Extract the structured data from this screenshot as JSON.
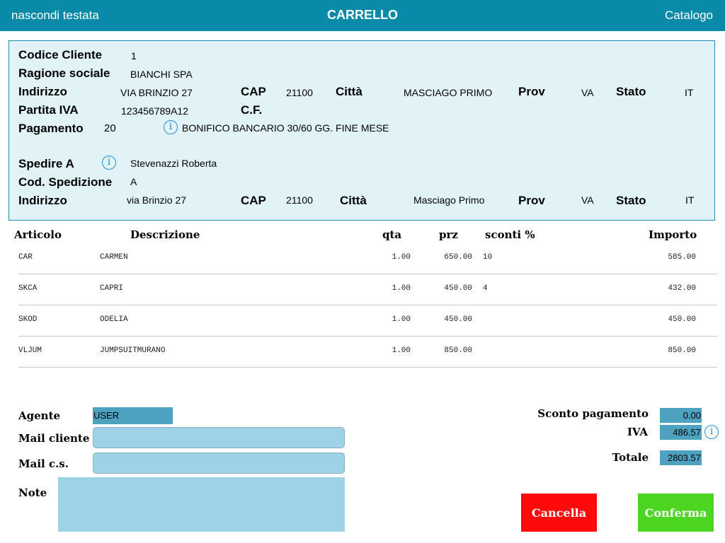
{
  "navbar": {
    "left": "nascondi testata",
    "title": "CARRELLO",
    "right": "Catalogo"
  },
  "header": {
    "codice_cliente": {
      "label": "Codice Cliente",
      "value": "1"
    },
    "ragione_sociale": {
      "label": "Ragione sociale",
      "value": "BIANCHI SPA"
    },
    "indirizzo": {
      "label": "Indirizzo",
      "value": "VIA BRINZIO 27",
      "cap_label": "CAP",
      "cap": "21100",
      "citta_label": "Città",
      "citta": "MASCIAGO PRIMO",
      "prov_label": "Prov",
      "prov": "VA",
      "stato_label": "Stato",
      "stato": "IT"
    },
    "partita_iva": {
      "label": "Partita IVA",
      "value": "123456789A12",
      "cf_label": "C.F.",
      "cf": ""
    },
    "pagamento": {
      "label": "Pagamento",
      "code": "20",
      "description": "BONIFICO BANCARIO 30/60 GG. FINE MESE"
    },
    "spedire_a": {
      "label": "Spedire A",
      "value": "Stevenazzi Roberta"
    },
    "cod_spedizione": {
      "label": "Cod. Spedizione",
      "value": "A"
    },
    "indirizzo_spedizione": {
      "label": "Indirizzo",
      "value": "via Brinzio 27",
      "cap_label": "CAP",
      "cap": "21100",
      "citta_label": "Città",
      "citta": "Masciago Primo",
      "prov_label": "Prov",
      "prov": "VA",
      "stato_label": "Stato",
      "stato": "IT"
    }
  },
  "table": {
    "columns": [
      "Articolo",
      "Descrizione",
      "qta",
      "prz",
      "sconti %",
      "Importo"
    ],
    "rows": [
      {
        "articolo": "CAR",
        "descrizione": "CARMEN",
        "qta": "1.00",
        "prz": "650.00",
        "sconti": "10",
        "importo": "585.00"
      },
      {
        "articolo": "SKCA",
        "descrizione": "CAPRI",
        "qta": "1.00",
        "prz": "450.00",
        "sconti": "4",
        "importo": "432.00"
      },
      {
        "articolo": "SKOD",
        "descrizione": "ODELIA",
        "qta": "1.00",
        "prz": "450.00",
        "sconti": "",
        "importo": "450.00"
      },
      {
        "articolo": "VLJUM",
        "descrizione": "JUMPSUITMURANO",
        "qta": "1.00",
        "prz": "850.00",
        "sconti": "",
        "importo": "850.00"
      }
    ]
  },
  "footer": {
    "agente_label": "Agente",
    "agente": "USER",
    "mail_cliente_label": "Mail cliente",
    "mail_cliente": "",
    "mail_cs_label": "Mail c.s.",
    "mail_cs": "",
    "note_label": "Note",
    "note": ""
  },
  "totals": {
    "sconto_pagamento_label": "Sconto pagamento",
    "sconto_pagamento": "0.00",
    "iva_label": "IVA",
    "iva": "486.57",
    "totale_label": "Totale",
    "totale": "2803.57"
  },
  "buttons": {
    "cancella": "Cancella",
    "conferma": "Conferma"
  },
  "colors": {
    "navbar": "#0a8aa9",
    "header_bg": "#e2f3f8",
    "field_dark": "#4ea2c0",
    "field_light": "#9ed2e6",
    "cancel": "#ff0a0a",
    "confirm": "#4cd621",
    "info": "#2a8fd0"
  },
  "icons": {
    "info": "info-icon"
  }
}
